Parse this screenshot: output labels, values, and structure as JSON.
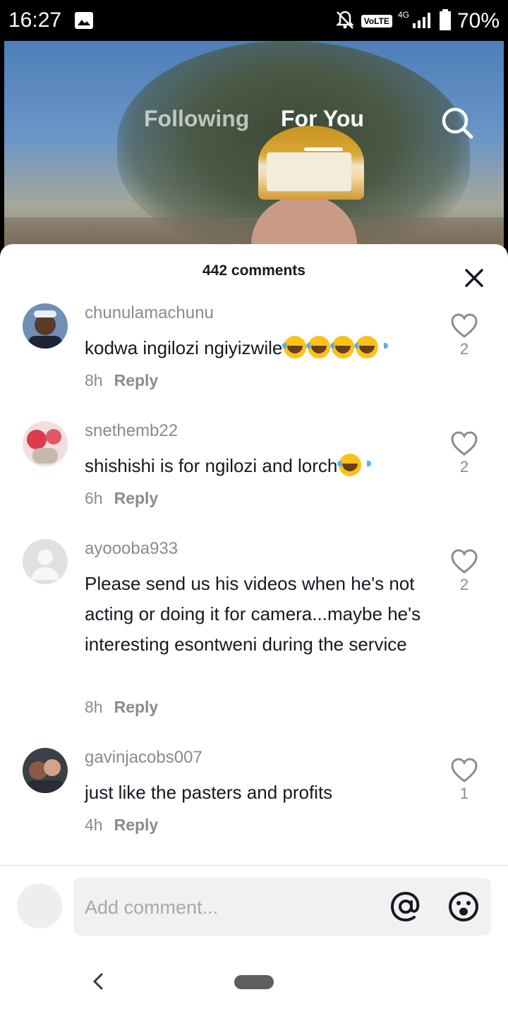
{
  "status_bar": {
    "time": "16:27",
    "network_label": "VoLTE",
    "network_type": "4G",
    "battery_text": "70%",
    "icons": [
      "gallery-icon",
      "mute-bell-icon",
      "signal-icon",
      "battery-icon"
    ]
  },
  "video_nav": {
    "following_label": "Following",
    "for_you_label": "For You",
    "active_tab": "For You",
    "search_icon": "search-icon"
  },
  "comments_sheet": {
    "title": "442 comments",
    "close_icon": "close-icon",
    "comments": [
      {
        "username": "chunulamachunu",
        "text": "kodwa ingilozi ngiyizwile",
        "emoji_count": 4,
        "time": "8h",
        "reply_label": "Reply",
        "likes": "2"
      },
      {
        "username": "snethemb22",
        "text": "shishishi is for ngilozi and lorch",
        "emoji_count": 1,
        "time": "6h",
        "reply_label": "Reply",
        "likes": "2"
      },
      {
        "username": "ayoooba933",
        "text": "Please send us his videos when he's not acting or doing it for camera...maybe he's interesting esontweni during the service",
        "emoji_count": 0,
        "time": "8h",
        "reply_label": "Reply",
        "likes": "2"
      },
      {
        "username": "gavinjacobs007",
        "text": "just like the pasters and profits",
        "emoji_count": 0,
        "time": "4h",
        "reply_label": "Reply",
        "likes": "1"
      }
    ]
  },
  "comment_input": {
    "placeholder": "Add comment...",
    "mention_icon": "at-icon",
    "emoji_icon": "emoji-icon"
  },
  "system_nav": {
    "back_icon": "back-icon",
    "home_icon": "home-pill-icon"
  },
  "colors": {
    "text_primary": "#161823",
    "text_secondary": "#8a8b91",
    "sheet_bg": "#ffffff",
    "input_bg": "#f1f1f2"
  }
}
